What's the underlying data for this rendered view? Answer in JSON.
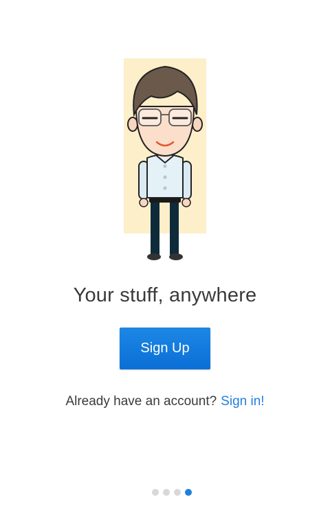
{
  "onboarding": {
    "headline": "Your stuff, anywhere",
    "signup_label": "Sign Up",
    "signin_prompt": "Already have an account?",
    "signin_link": "Sign in!"
  },
  "illustration": {
    "icon": "person-with-glasses-illustration",
    "background_color": "#fdefc9"
  },
  "pager": {
    "total_pages": 4,
    "current_page": 4
  },
  "colors": {
    "accent": "#1f7fdc",
    "button": "#0b6fd6",
    "text": "#3a3a3a",
    "inactive_dot": "#d8d8d8"
  }
}
